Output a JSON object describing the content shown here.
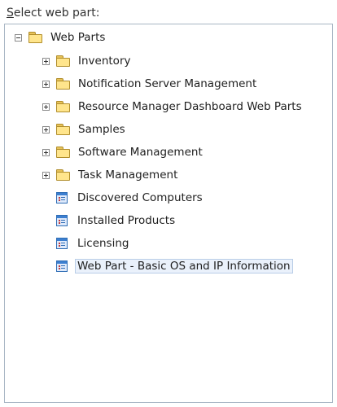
{
  "label": {
    "accel": "S",
    "rest": "elect web part:"
  },
  "tree": {
    "root": "Web Parts",
    "folders": [
      "Inventory",
      "Notification Server Management",
      "Resource Manager Dashboard Web Parts",
      "Samples",
      "Software Management",
      "Task Management"
    ],
    "webparts": [
      "Discovered Computers",
      "Installed Products",
      "Licensing",
      "Web Part - Basic OS and IP Information"
    ],
    "selected": "Web Part - Basic OS and IP Information"
  }
}
